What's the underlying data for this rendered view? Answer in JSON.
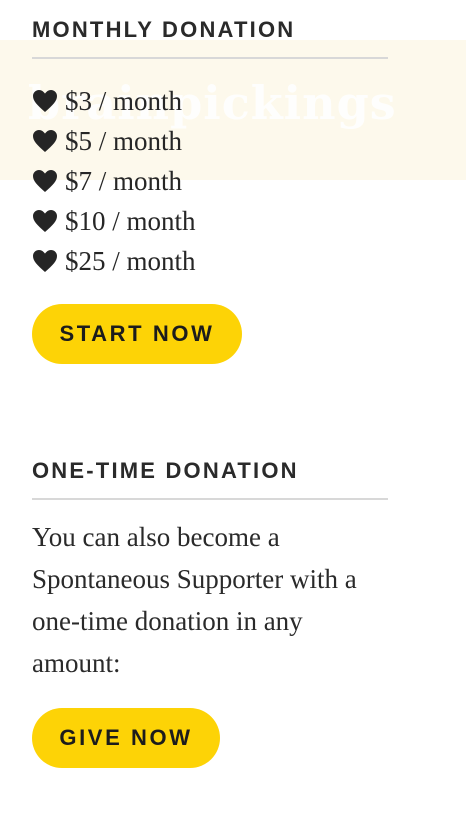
{
  "background": {
    "band_color": "#fdf9ec",
    "ghost_logo": "brainpickings"
  },
  "monthly": {
    "heading": "MONTHLY DONATION",
    "heart_icon": "heart-icon",
    "tiers": [
      {
        "label": "$3 / month"
      },
      {
        "label": "$5 / month"
      },
      {
        "label": "$7 / month"
      },
      {
        "label": "$10 / month"
      },
      {
        "label": "$25 / month"
      }
    ],
    "button_label": "START NOW"
  },
  "onetime": {
    "heading": "ONE-TIME DONATION",
    "text": "You can also become a Spontaneous Supporter with a one-time donation in any amount:",
    "button_label": "GIVE NOW"
  },
  "colors": {
    "button_yellow": "#fdd306",
    "text_dark": "#262626",
    "divider": "#d8d8d8"
  }
}
